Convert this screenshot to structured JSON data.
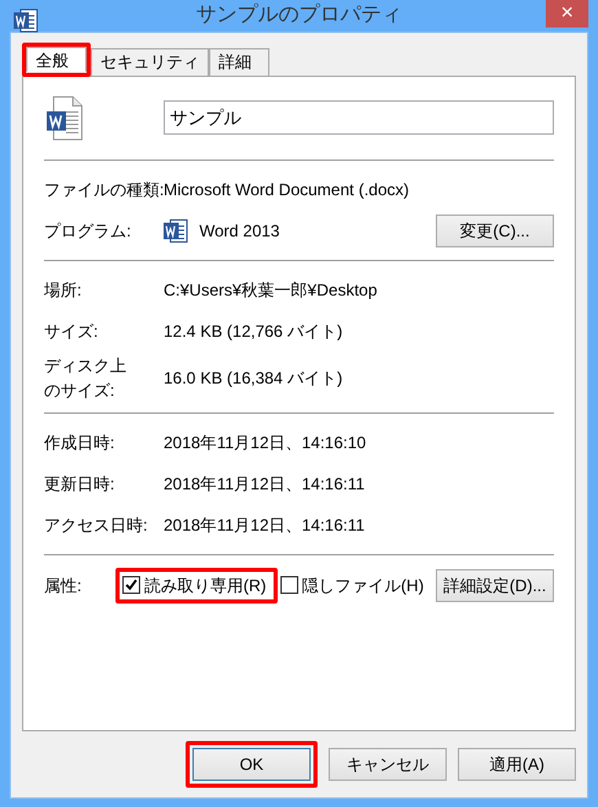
{
  "window": {
    "title": "サンプルのプロパティ",
    "close": "×"
  },
  "tabs": [
    {
      "label": "全般",
      "selected": true,
      "highlighted": true
    },
    {
      "label": "セキュリティ",
      "selected": false,
      "highlighted": false
    },
    {
      "label": "詳細",
      "selected": false,
      "highlighted": false
    }
  ],
  "file_name": "サンプル",
  "sections": [
    [
      {
        "kind": "text",
        "label": "ファイルの種類:",
        "value": "Microsoft Word Document (.docx)"
      },
      {
        "kind": "program",
        "label": "プログラム:",
        "value": "Word 2013",
        "button": "変更(C)..."
      }
    ],
    [
      {
        "kind": "text",
        "label": "場所:",
        "value": "C:¥Users¥秋葉一郎¥Desktop"
      },
      {
        "kind": "text",
        "label": "サイズ:",
        "value": "12.4 KB (12,766 バイト)"
      },
      {
        "kind": "tall",
        "label_lines": [
          "ディスク上",
          "のサイズ:"
        ],
        "value": "16.0 KB (16,384 バイト)"
      }
    ],
    [
      {
        "kind": "text",
        "label": "作成日時:",
        "value": "2018年11月12日、14:16:10"
      },
      {
        "kind": "text",
        "label": "更新日時:",
        "value": "2018年11月12日、14:16:11"
      },
      {
        "kind": "text",
        "label": "アクセス日時:",
        "value": "2018年11月12日、14:16:11"
      }
    ]
  ],
  "attributes": {
    "label": "属性:",
    "options": [
      {
        "label": "読み取り専用(R)",
        "checked": true,
        "highlighted": true
      },
      {
        "label": "隠しファイル(H)",
        "checked": false,
        "highlighted": false
      }
    ],
    "button": "詳細設定(D)..."
  },
  "buttons": [
    {
      "label": "OK",
      "highlighted": true
    },
    {
      "label": "キャンセル",
      "highlighted": false
    },
    {
      "label": "適用(A)",
      "highlighted": false
    }
  ]
}
